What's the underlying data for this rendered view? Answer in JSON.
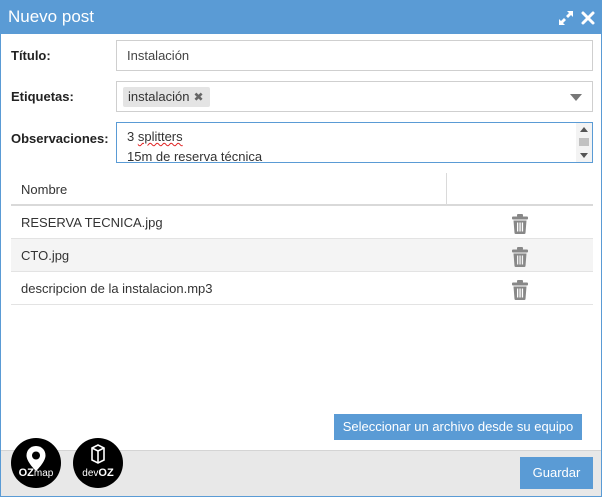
{
  "window": {
    "title": "Nuevo post"
  },
  "form": {
    "titulo_label": "Título:",
    "titulo_value": "Instalación",
    "etiquetas_label": "Etiquetas:",
    "tags": [
      {
        "label": "instalación",
        "remove_glyph": "✖"
      }
    ],
    "observaciones_label": "Observaciones:",
    "observaciones_lines": [
      "3 splitters",
      "15m de reserva técnica"
    ]
  },
  "files": {
    "column_header": "Nombre",
    "rows": [
      {
        "name": "RESERVA TECNICA.jpg"
      },
      {
        "name": "CTO.jpg"
      },
      {
        "name": "descripcion de la instalacion.mp3"
      }
    ]
  },
  "buttons": {
    "select_file": "Seleccionar un archivo desde su equipo",
    "save": "Guardar"
  },
  "logos": {
    "ozmap": {
      "brand": "OZ",
      "suffix": "map"
    },
    "devoz": {
      "prefix": "dev",
      "brand": "OZ"
    }
  },
  "icons": {
    "expand": "expand-icon",
    "close": "close-icon",
    "trash": "trash-icon",
    "dropdown": "chevron-down-icon"
  },
  "colors": {
    "accent": "#5a9bd5",
    "footer_bg": "#e8e8e8",
    "trash": "#888888"
  }
}
